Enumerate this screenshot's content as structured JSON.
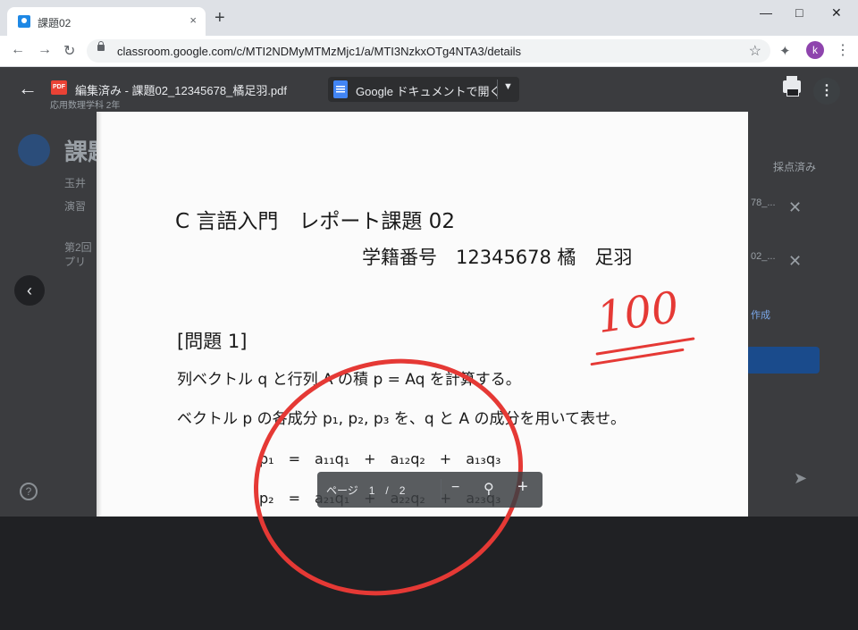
{
  "browser": {
    "tab_title": "課題02",
    "tab_close": "×",
    "new_tab": "+",
    "url": "classroom.google.com/c/MTI2NDMyMTMzMjc1/a/MTI3NzkxOTg4NTA3/details",
    "profile_initial": "k"
  },
  "viewer": {
    "file_name": "編集済み - 課題02_12345678_橘足羽.pdf",
    "file_sub": "応用数理学科 2年",
    "pdf_badge": "PDF",
    "open_with": "Google ドキュメントで開く"
  },
  "background": {
    "title": "課題",
    "lines": [
      "玉井",
      "演習",
      "第2回",
      "プリ"
    ],
    "status": "採点済み",
    "file_snippets": [
      "78_...",
      "02_..."
    ],
    "link_snippet": "作成"
  },
  "document": {
    "line1": "C 言語入門　レポート課題 02",
    "line2": "学籍番号　12345678 橘　足羽",
    "line3": "[問題 1]",
    "line4": "列ベクトル q と行列 A の積 p = Aq を計算する。",
    "line5": "ベクトル p の各成分 p₁, p₂, p₃ を、q と A の成分を用いて表せ。",
    "eq1": "p₁　=　a₁₁q₁　+　a₁₂q₂　+　a₁₃q₃",
    "eq2": "p₂　=　a₂₁q₁　+　a₂₂q₂　+　a₂₃q₃",
    "score": "100"
  },
  "page_controls": {
    "label": "ページ　1　/　2",
    "minus": "−",
    "plus": "+"
  },
  "colors": {
    "red_mark": "#e53935",
    "chrome_tab_bg": "#dee1e6",
    "viewer_bg": "#202124"
  }
}
